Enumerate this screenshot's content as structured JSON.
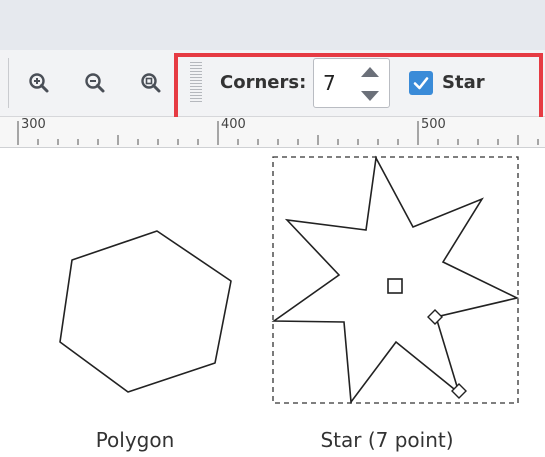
{
  "toolbar": {
    "zoom_buttons": [
      {
        "icon": "zoom-in-icon"
      },
      {
        "icon": "zoom-out-icon"
      },
      {
        "icon": "zoom-fit-icon"
      }
    ],
    "corners_label": "Corners:",
    "corners_value": "7",
    "star_checkbox": {
      "label": "Star",
      "checked": true
    },
    "highlight_color": "#e63b43",
    "accent_color": "#3a8bd8"
  },
  "ruler": {
    "labels": [
      "300",
      "400",
      "500"
    ]
  },
  "canvas": {
    "shapes": [
      {
        "type": "polygon",
        "corners": 6,
        "caption": "Polygon"
      },
      {
        "type": "star",
        "corners": 7,
        "caption": "Star (7 point)",
        "selected": true
      }
    ]
  }
}
